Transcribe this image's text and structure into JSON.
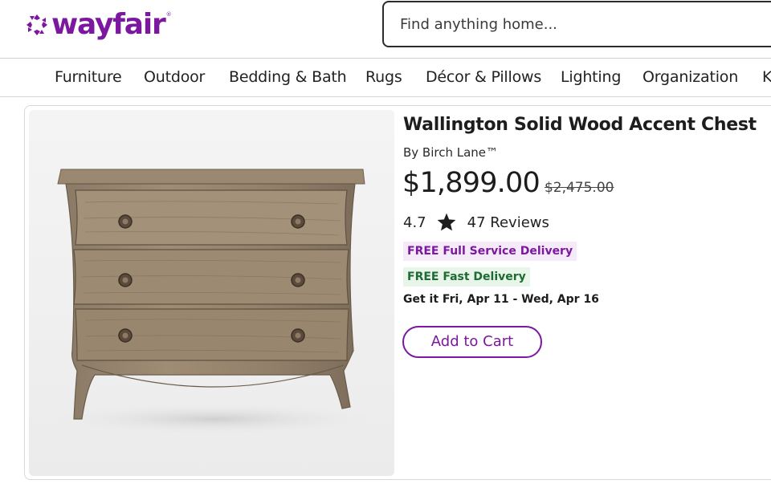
{
  "header": {
    "logo_text": "wayfair",
    "logo_mark": "wayfair-logo-mark",
    "brand_color": "#7b189f",
    "search": {
      "placeholder": "Find anything home...",
      "value": ""
    }
  },
  "nav": {
    "items": [
      {
        "label": "Furniture"
      },
      {
        "label": "Outdoor"
      },
      {
        "label": "Bedding & Bath"
      },
      {
        "label": "Rugs"
      },
      {
        "label": "Décor & Pillows"
      },
      {
        "label": "Lighting"
      },
      {
        "label": "Organization"
      },
      {
        "label": "K"
      }
    ]
  },
  "product": {
    "image_icon": "wood-chest-photo",
    "title": "Wallington Solid Wood Accent Chest",
    "brand": "By Birch Lane™",
    "price": "$1,899.00",
    "was_price": "$2,475.00",
    "rating": "4.7",
    "rating_icon": "star-icon",
    "reviews": "47 Reviews",
    "badges": {
      "full_service": "FREE Full Service Delivery",
      "fast": "FREE Fast Delivery"
    },
    "eta": "Get it Fri, Apr 11 - Wed, Apr 16",
    "add_to_cart": "Add to Cart"
  },
  "colors": {
    "accent": "#7b189f",
    "badge_purple_bg": "#f4eaf8",
    "badge_green_bg": "#e8f5e9",
    "badge_green_text": "#1d6a33"
  }
}
